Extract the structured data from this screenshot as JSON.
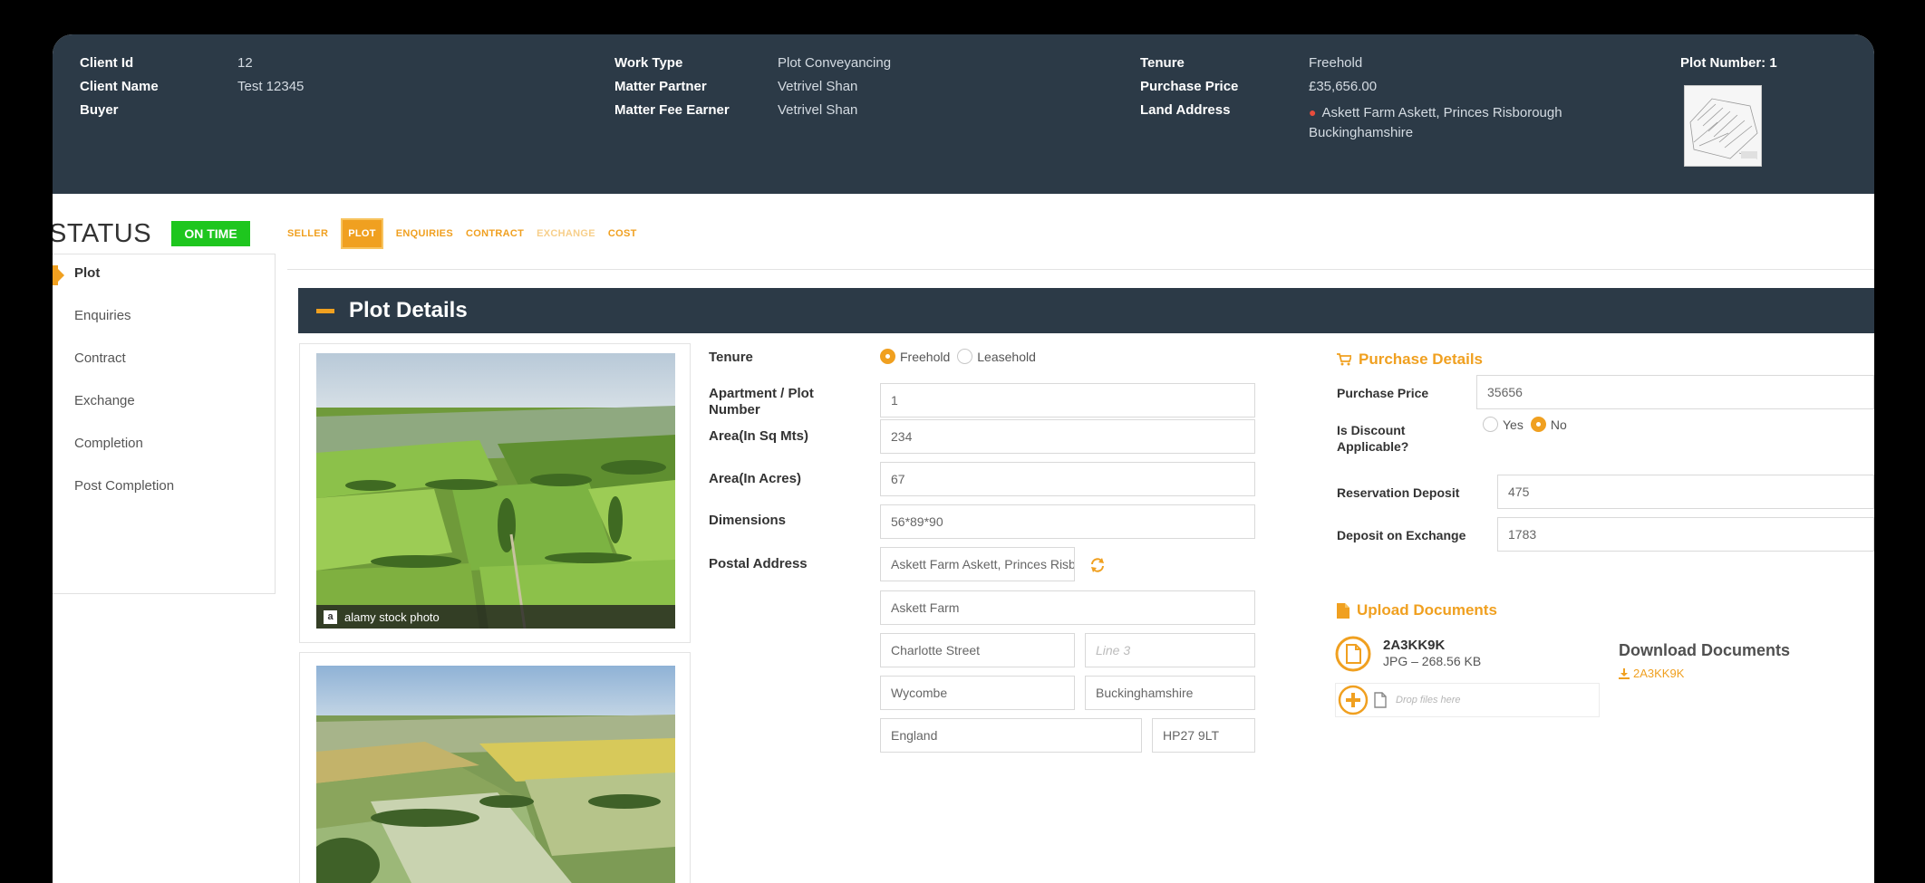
{
  "header": {
    "client_id_label": "Client Id",
    "client_id": "12",
    "client_name_label": "Client Name",
    "client_name": "Test 12345",
    "buyer_label": "Buyer",
    "buyer": "",
    "work_type_label": "Work Type",
    "work_type": "Plot Conveyancing",
    "matter_partner_label": "Matter Partner",
    "matter_partner": "Vetrivel Shan",
    "matter_fee_earner_label": "Matter Fee Earner",
    "matter_fee_earner": "Vetrivel Shan",
    "tenure_label": "Tenure",
    "tenure": "Freehold",
    "purchase_price_label": "Purchase Price",
    "purchase_price": "£35,656.00",
    "land_address_label": "Land Address",
    "land_address_line1": "Askett Farm Askett, Princes Risborough",
    "land_address_line2": "Buckinghamshire",
    "plot_number": "Plot Number: 1"
  },
  "status": {
    "label": "STATUS",
    "badge": "ON TIME",
    "badge_color": "#1ec61e"
  },
  "tabs": [
    {
      "label": "SELLER",
      "state": "normal"
    },
    {
      "label": "PLOT",
      "state": "active"
    },
    {
      "label": "ENQUIRIES",
      "state": "normal"
    },
    {
      "label": "CONTRACT",
      "state": "normal"
    },
    {
      "label": "EXCHANGE",
      "state": "faded"
    },
    {
      "label": "COST",
      "state": "normal"
    }
  ],
  "sidenav": {
    "items": [
      {
        "label": "Plot",
        "active": true
      },
      {
        "label": "Enquiries"
      },
      {
        "label": "Contract"
      },
      {
        "label": "Exchange"
      },
      {
        "label": "Completion"
      },
      {
        "label": "Post Completion"
      }
    ]
  },
  "section": {
    "title": "Plot Details"
  },
  "photos": {
    "watermark": "alamy stock photo",
    "watermark_logo": "a"
  },
  "form": {
    "tenure_label": "Tenure",
    "tenure_options": [
      "Freehold",
      "Leasehold"
    ],
    "tenure_selected": "Freehold",
    "plot_number_label": "Apartment / Plot Number",
    "plot_number": "1",
    "area_sqm_label": "Area(In Sq Mts)",
    "area_sqm": "234",
    "area_acres_label": "Area(In Acres)",
    "area_acres": "67",
    "dimensions_label": "Dimensions",
    "dimensions": "56*89*90",
    "postal_address_label": "Postal Address",
    "address_line1": "Askett Farm Askett, Princes Risborough",
    "address_line2": "Askett Farm",
    "address_line3": "Charlotte Street",
    "address_line4_placeholder": "Line 3",
    "town": "Wycombe",
    "county": "Buckinghamshire",
    "country": "England",
    "postcode": "HP27 9LT"
  },
  "purchase": {
    "heading": "Purchase Details",
    "price_label": "Purchase Price",
    "price": "35656",
    "discount_label": "Is Discount Applicable?",
    "discount_options": [
      "Yes",
      "No"
    ],
    "discount_selected": "No",
    "reservation_label": "Reservation Deposit",
    "reservation": "475",
    "exchange_deposit_label": "Deposit on Exchange",
    "exchange_deposit": "1783"
  },
  "upload": {
    "heading": "Upload Documents",
    "file_name": "2A3KK9K",
    "file_meta": "JPG – 268.56 KB",
    "drop_text": "Drop files here"
  },
  "download": {
    "heading": "Download Documents",
    "link": "2A3KK9K"
  },
  "colors": {
    "accent": "#f0a020",
    "header_bg": "#2c3a47"
  }
}
